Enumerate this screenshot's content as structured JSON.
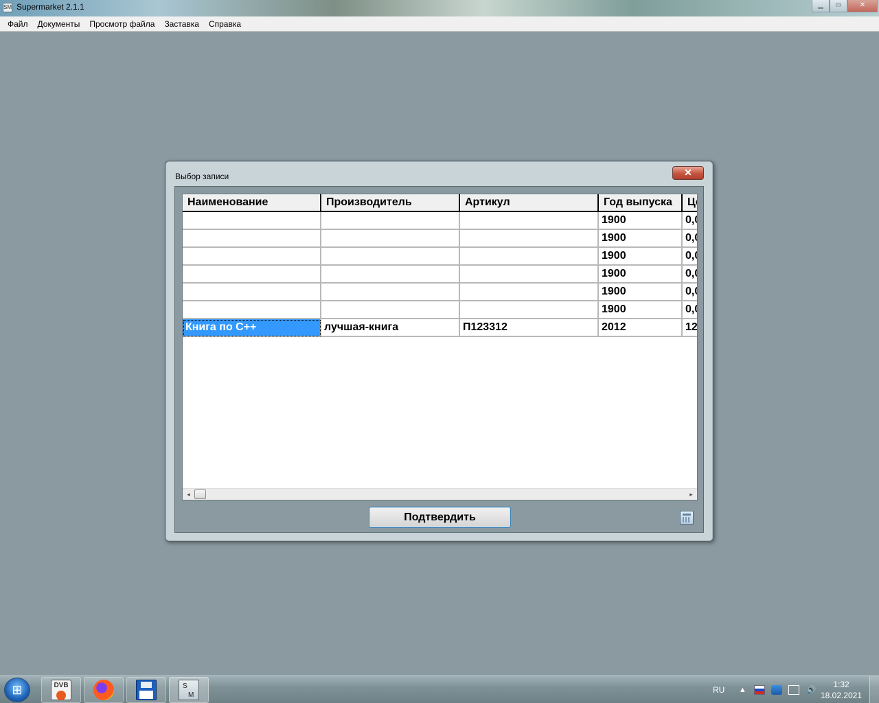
{
  "app": {
    "title": "Supermarket 2.1.1",
    "icon_label": "SM",
    "window_controls": {
      "minimize": "▁",
      "maximize": "▭",
      "close": "✕"
    }
  },
  "menu": [
    "Файл",
    "Документы",
    "Просмотр файла",
    "Заставка",
    "Справка"
  ],
  "dialog": {
    "title": "Выбор записи",
    "close_glyph": "✕",
    "confirm_label": "Подтвердить",
    "columns": [
      "Наименование",
      "Производитель",
      "Артикул",
      "Год выпуска",
      "Це"
    ],
    "rows": [
      [
        "",
        "",
        "",
        "1900",
        "0,0"
      ],
      [
        "",
        "",
        "",
        "1900",
        "0,0"
      ],
      [
        "",
        "",
        "",
        "1900",
        "0,0"
      ],
      [
        "",
        "",
        "",
        "1900",
        "0,0"
      ],
      [
        "",
        "",
        "",
        "1900",
        "0,0"
      ],
      [
        "",
        "",
        "",
        "1900",
        "0,0"
      ],
      [
        "Книга по С++",
        "лучшая-книга",
        "П123312",
        "2012",
        "12"
      ]
    ],
    "selected_row": 6,
    "selected_col": 0,
    "scroll_left_glyph": "◂",
    "scroll_right_glyph": "▸"
  },
  "taskbar": {
    "start_glyph": "⊞",
    "apps": [
      {
        "name": "dvb-app",
        "icon": "dvb-icon",
        "label": "DVB"
      },
      {
        "name": "firefox",
        "icon": "firefox-icon"
      },
      {
        "name": "floppy-app",
        "icon": "floppy-disk-icon"
      },
      {
        "name": "supermarket",
        "icon": "sm-icon",
        "label_top": "S",
        "label_bottom": "M"
      }
    ],
    "language": "RU",
    "tray_glyphs": {
      "arrow": "▲",
      "speaker": "🔊"
    },
    "time": "1:32",
    "date": "18.02.2021"
  },
  "colors": {
    "selection": "#3399ff",
    "desktop": "#8a9aa0",
    "close_button": "#c4543f"
  }
}
